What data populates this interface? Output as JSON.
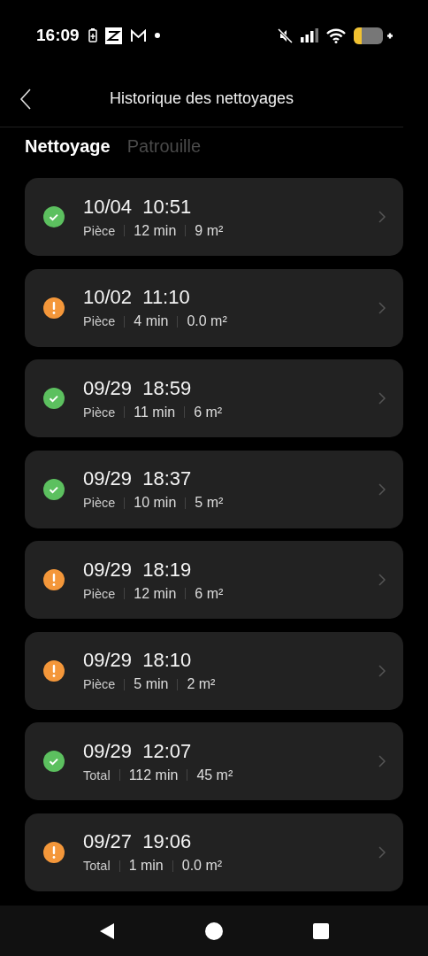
{
  "status_bar": {
    "time": "16:09"
  },
  "header": {
    "title": "Historique des nettoyages"
  },
  "tabs": [
    {
      "label": "Nettoyage",
      "selected": true
    },
    {
      "label": "Patrouille",
      "selected": false
    }
  ],
  "records": [
    {
      "kind": "success",
      "datetime": "10/04  10:51",
      "mode": "Pièce",
      "duration": "12 min",
      "area": "9 m²"
    },
    {
      "kind": "warning",
      "datetime": "10/02  11:10",
      "mode": "Pièce",
      "duration": "4 min",
      "area": "0.0 m²"
    },
    {
      "kind": "success",
      "datetime": "09/29  18:59",
      "mode": "Pièce",
      "duration": "11 min",
      "area": "6 m²"
    },
    {
      "kind": "success",
      "datetime": "09/29  18:37",
      "mode": "Pièce",
      "duration": "10 min",
      "area": "5 m²"
    },
    {
      "kind": "warning",
      "datetime": "09/29  18:19",
      "mode": "Pièce",
      "duration": "12 min",
      "area": "6 m²"
    },
    {
      "kind": "warning",
      "datetime": "09/29  18:10",
      "mode": "Pièce",
      "duration": "5 min",
      "area": "2 m²"
    },
    {
      "kind": "success",
      "datetime": "09/29  12:07",
      "mode": "Total",
      "duration": "112 min",
      "area": "45 m²"
    },
    {
      "kind": "warning",
      "datetime": "09/27  19:06",
      "mode": "Total",
      "duration": "1 min",
      "area": "0.0 m²"
    }
  ]
}
